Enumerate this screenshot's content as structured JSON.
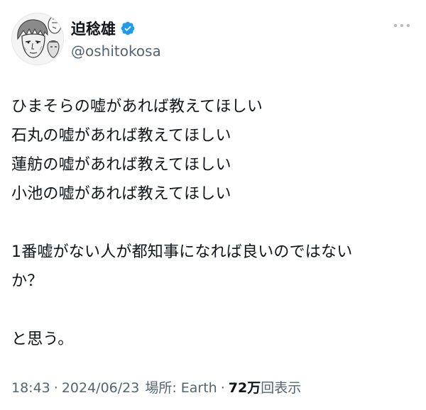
{
  "user": {
    "display_name": "迫稔雄",
    "handle": "@oshitokosa",
    "verified": true
  },
  "tweet": {
    "lines": [
      "ひまそらの嘘があれば教えてほしい",
      "石丸の嘘があれば教えてほしい",
      "蓮舫の嘘があれば教えてほしい",
      "小池の嘘があれば教えてほしい",
      "",
      "1番嘘がない人が都知事になれば良いのではない",
      "か？",
      "",
      "と思う。"
    ]
  },
  "meta": {
    "time": "18:43",
    "date": "2024/06/23",
    "location_label": "場所: Earth",
    "views_count": "72万",
    "views_label": "回表示",
    "separator": "·"
  },
  "colors": {
    "verified": "#1d9bf0",
    "secondary_text": "#536471",
    "primary_text": "#0f1419"
  },
  "icons": {
    "verified": "verified-badge-icon",
    "more": "more-horizontal-icon"
  }
}
